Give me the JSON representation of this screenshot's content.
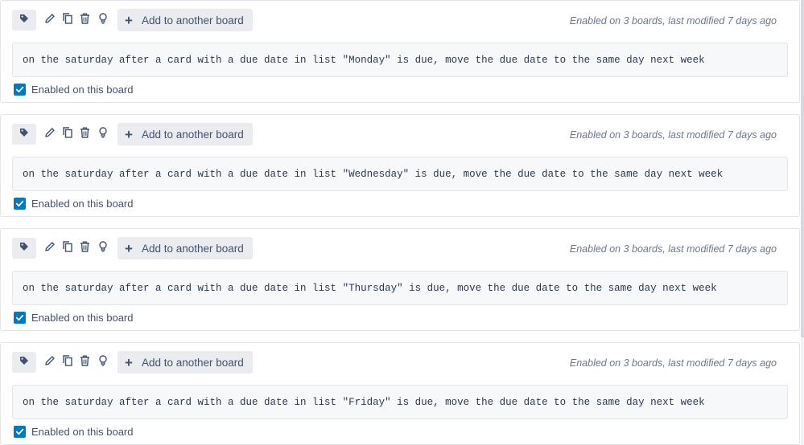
{
  "rules": [
    {
      "add_label": "Add to another board",
      "meta": "Enabled on 3 boards, last modified 7 days ago",
      "text": "on the saturday after a card with a due date in list \"Monday\" is due, move the due date to the same day next week",
      "enabled_label": "Enabled on this board",
      "enabled": true
    },
    {
      "add_label": "Add to another board",
      "meta": "Enabled on 3 boards, last modified 7 days ago",
      "text": "on the saturday after a card with a due date in list \"Wednesday\" is due, move the due date to the same day next week",
      "enabled_label": "Enabled on this board",
      "enabled": true
    },
    {
      "add_label": "Add to another board",
      "meta": "Enabled on 3 boards, last modified 7 days ago",
      "text": "on the saturday after a card with a due date in list \"Thursday\" is due, move the due date to the same day next week",
      "enabled_label": "Enabled on this board",
      "enabled": true
    },
    {
      "add_label": "Add to another board",
      "meta": "Enabled on 3 boards, last modified 7 days ago",
      "text": "on the saturday after a card with a due date in list \"Friday\" is due, move the due date to the same day next week",
      "enabled_label": "Enabled on this board",
      "enabled": true
    }
  ],
  "icons": {
    "tag": "tag-icon",
    "edit": "pencil-icon",
    "copy": "copy-icon",
    "delete": "trash-icon",
    "idea": "lightbulb-icon",
    "add": "plus-icon",
    "check": "checkmark-icon"
  },
  "colors": {
    "accent": "#0079bf",
    "button_bg": "#ebecf0",
    "meta_text": "#6b778c",
    "rule_text_bg": "#f7f8f9"
  }
}
